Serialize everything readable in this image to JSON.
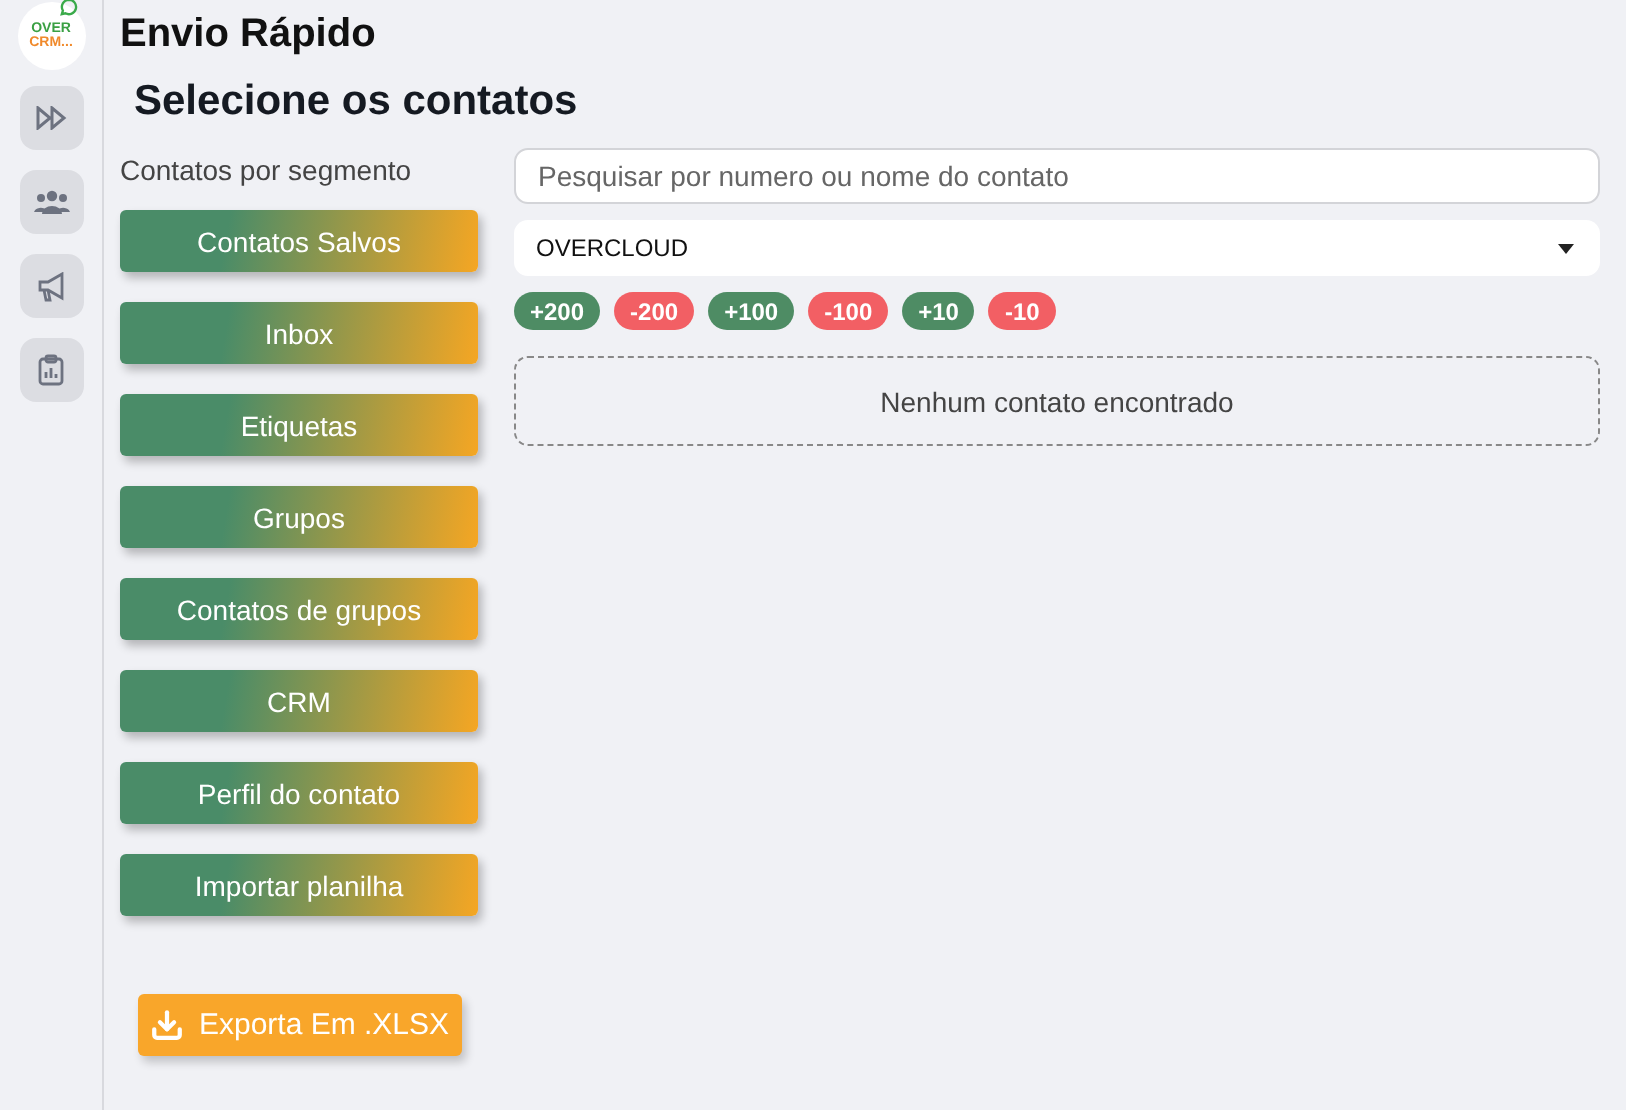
{
  "logo": {
    "line_1": "OVER",
    "line_2": "CRM..."
  },
  "nav": [
    {
      "kind": "forward",
      "selected": false
    },
    {
      "kind": "users",
      "selected": false
    },
    {
      "kind": "megaphone",
      "selected": false
    },
    {
      "kind": "clipboard",
      "selected": false
    }
  ],
  "title": "Envio Rápido",
  "subtitle": "Selecione os contatos",
  "segments": {
    "label": "Contatos por segmento",
    "buttons": [
      "Contatos Salvos",
      "Inbox",
      "Etiquetas",
      "Grupos",
      "Contatos de grupos",
      "CRM",
      "Perfil do contato",
      "Importar planilha"
    ]
  },
  "export_button": "Exporta Em .XLSX",
  "search": {
    "placeholder": "Pesquisar por numero ou nome do contato"
  },
  "connection_select": {
    "value": "OVERCLOUD"
  },
  "quick_counts": [
    {
      "label": "+200",
      "color": "#4e8c64"
    },
    {
      "label": "-200",
      "color": "#f25f64"
    },
    {
      "label": "+100",
      "color": "#4e8c64"
    },
    {
      "label": "-100",
      "color": "#f25f64"
    },
    {
      "label": "+10",
      "color": "#4e8c64"
    },
    {
      "label": "-10",
      "color": "#f25f64"
    }
  ],
  "empty_message": "Nenhum contato encontrado"
}
